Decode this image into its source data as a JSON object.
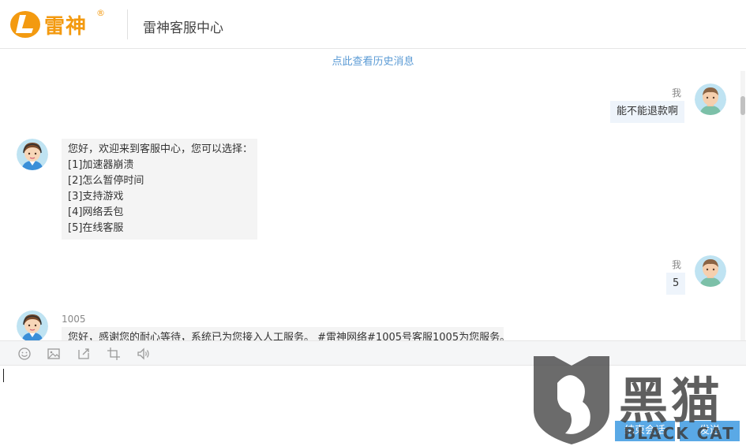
{
  "header": {
    "logo_text": "雷神",
    "logo_reg": "®",
    "title": "雷神客服中心"
  },
  "chat": {
    "history_link": "点此查看历史消息",
    "messages": [
      {
        "side": "right",
        "sender": "我",
        "text": "能不能退款啊"
      },
      {
        "side": "left",
        "sender": "",
        "lines": [
          "您好，欢迎来到客服中心，您可以选择：",
          "[1]加速器崩溃",
          "[2]怎么暂停时间",
          "[3]支持游戏",
          "[4]网络丢包",
          "[5]在线客服"
        ]
      },
      {
        "side": "right",
        "sender": "我",
        "text": "5"
      },
      {
        "side": "left",
        "sender": "1005",
        "lines": [
          "您好，感谢您的耐心等待，系统已为您接入人工服务。 #雷神网络#1005号客服1005为您服务。"
        ]
      }
    ]
  },
  "toolbar": {
    "icons": [
      "emoji-icon",
      "image-icon",
      "file-upload-icon",
      "screenshot-icon",
      "voice-icon"
    ]
  },
  "input": {
    "value": ""
  },
  "buttons": {
    "end_label": "结束会话",
    "send_label": "发送"
  },
  "watermark": {
    "cn": "黑猫",
    "en": "BLACK CAT"
  },
  "colors": {
    "brand": "#f39a10",
    "accent": "#5aa9e6",
    "link": "#5b9bd5"
  }
}
